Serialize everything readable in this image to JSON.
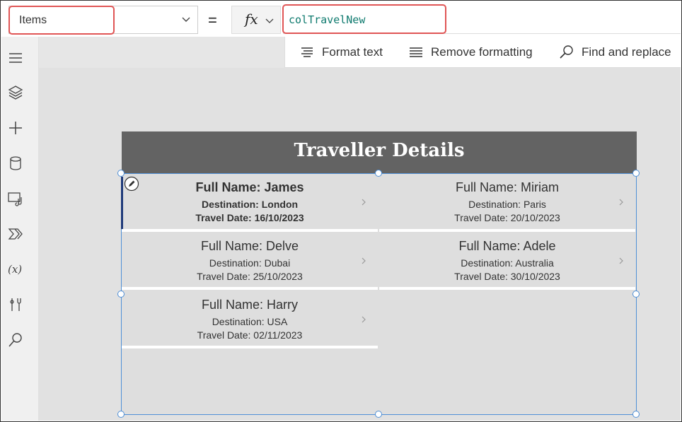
{
  "formula_bar": {
    "property_value": "Items",
    "equals": "=",
    "fx_label": "fx",
    "formula": "colTravelNew"
  },
  "toolbar": {
    "format_text": "Format text",
    "remove_formatting": "Remove formatting",
    "find_replace": "Find and replace"
  },
  "rail": {
    "icons": [
      "hamburger-icon",
      "layers-icon",
      "plus-icon",
      "database-icon",
      "media-icon",
      "power-automate-icon",
      "variables-icon",
      "tools-icon",
      "search-icon"
    ]
  },
  "screen": {
    "header_title": "Traveller Details",
    "items": [
      {
        "name": "Full Name: James",
        "destination": "Destination: London",
        "date": "Travel Date: 16/10/2023"
      },
      {
        "name": "Full Name: Miriam",
        "destination": "Destination: Paris",
        "date": "Travel Date: 20/10/2023"
      },
      {
        "name": "Full Name: Delve",
        "destination": "Destination: Dubai",
        "date": "Travel Date: 25/10/2023"
      },
      {
        "name": "Full Name: Adele",
        "destination": "Destination: Australia",
        "date": "Travel Date: 30/10/2023"
      },
      {
        "name": "Full Name: Harry",
        "destination": "Destination: USA",
        "date": "Travel Date: 02/11/2023"
      }
    ]
  }
}
